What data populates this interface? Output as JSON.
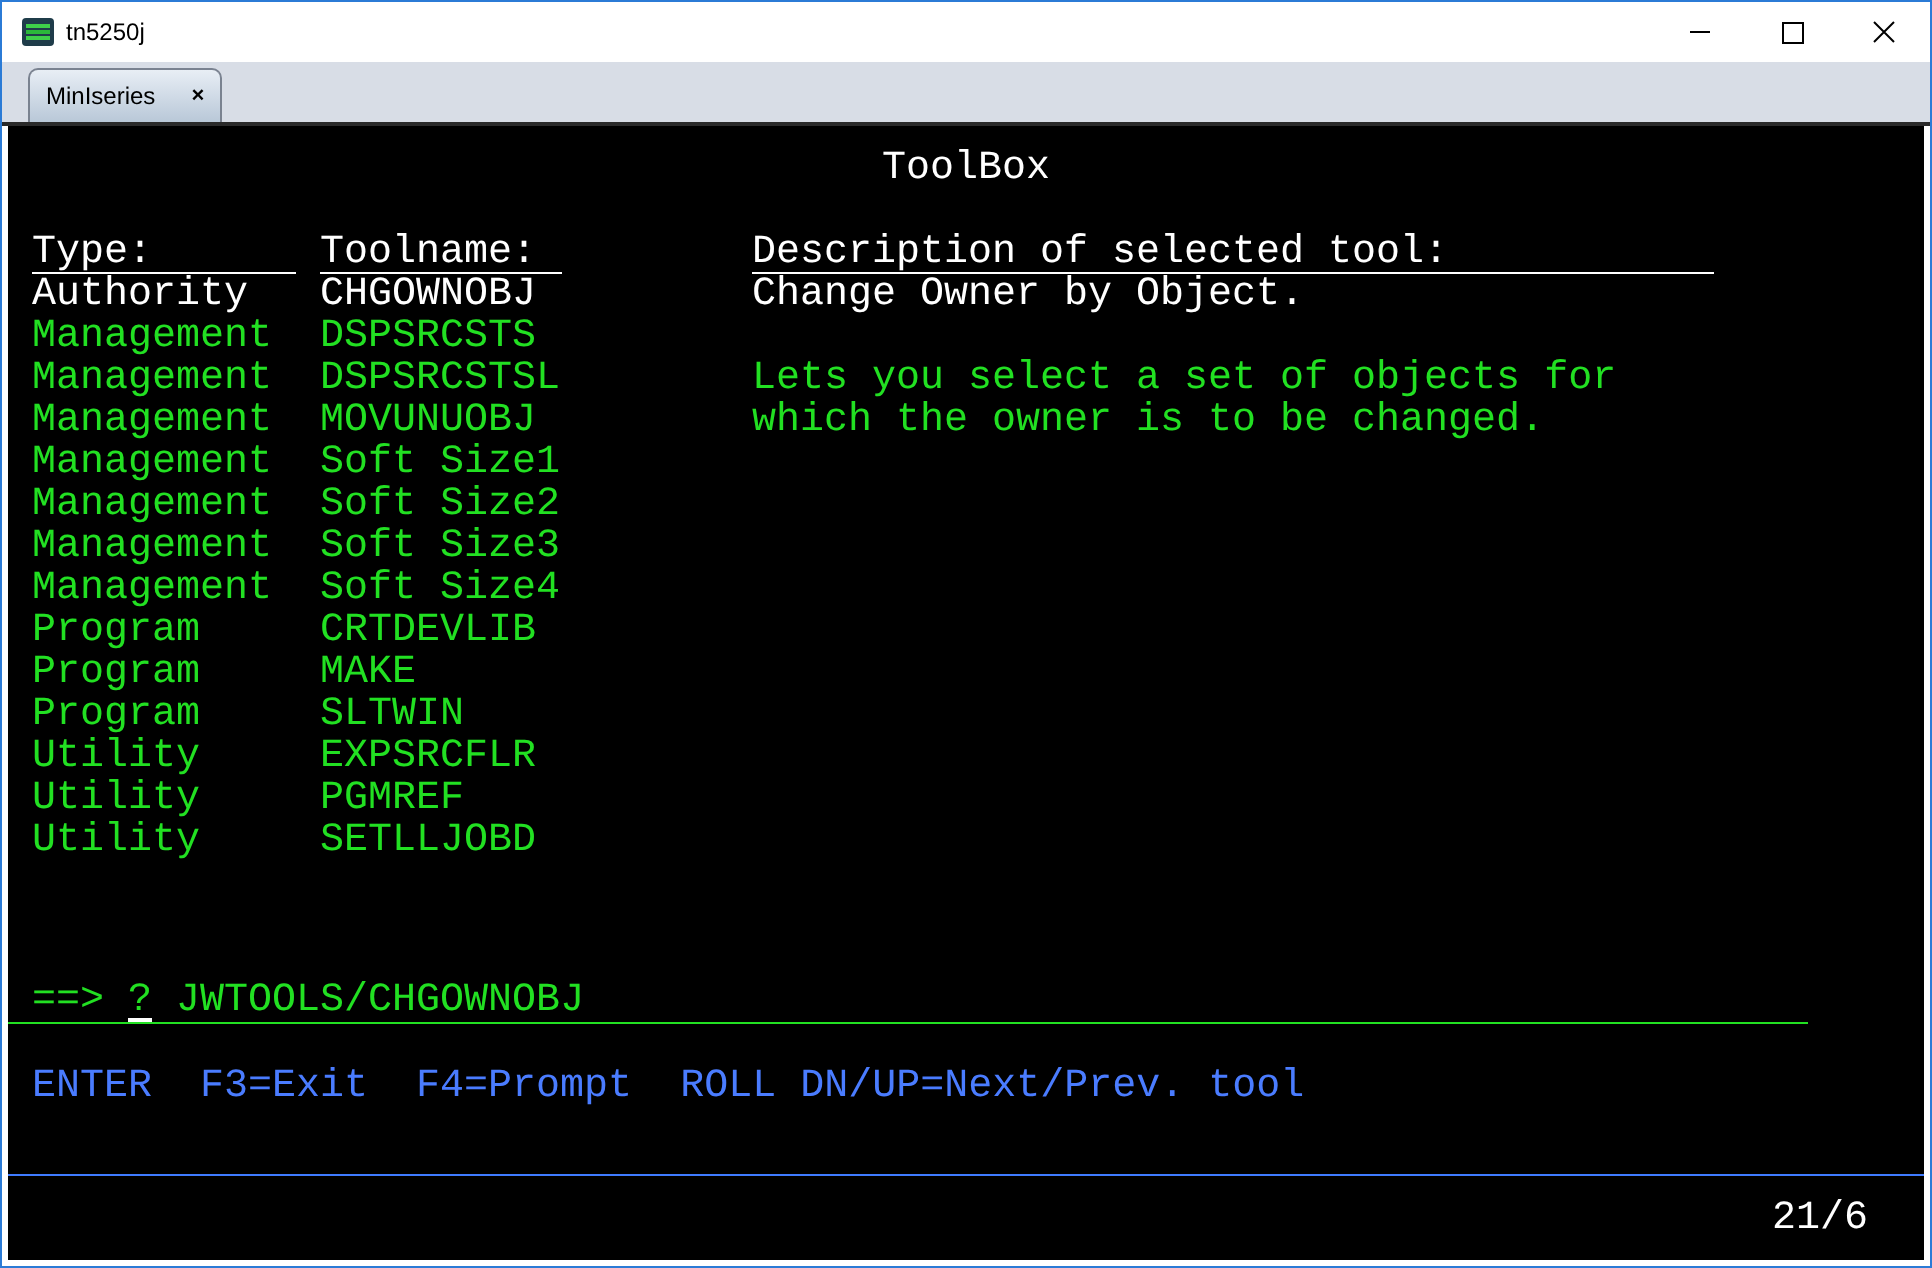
{
  "window": {
    "title": "tn5250j"
  },
  "tabs": [
    {
      "label": "MinIseries",
      "close": "×",
      "selected": true
    }
  ],
  "screen": {
    "title": "ToolBox",
    "columns": [
      "Type:",
      "Toolname:",
      "Description of selected tool:"
    ],
    "rows": [
      {
        "type": "Authority",
        "toolname": "CHGOWNOBJ",
        "selected": true
      },
      {
        "type": "Management",
        "toolname": "DSPSRCSTS",
        "selected": false
      },
      {
        "type": "Management",
        "toolname": "DSPSRCSTSL",
        "selected": false
      },
      {
        "type": "Management",
        "toolname": "MOVUNUOBJ",
        "selected": false
      },
      {
        "type": "Management",
        "toolname": "Soft Size1",
        "selected": false
      },
      {
        "type": "Management",
        "toolname": "Soft Size2",
        "selected": false
      },
      {
        "type": "Management",
        "toolname": "Soft Size3",
        "selected": false
      },
      {
        "type": "Management",
        "toolname": "Soft Size4",
        "selected": false
      },
      {
        "type": "Program",
        "toolname": "CRTDEVLIB",
        "selected": false
      },
      {
        "type": "Program",
        "toolname": "MAKE",
        "selected": false
      },
      {
        "type": "Program",
        "toolname": "SLTWIN",
        "selected": false
      },
      {
        "type": "Utility",
        "toolname": "EXPSRCFLR",
        "selected": false
      },
      {
        "type": "Utility",
        "toolname": "PGMREF",
        "selected": false
      },
      {
        "type": "Utility",
        "toolname": "SETLLJOBD",
        "selected": false
      }
    ],
    "description": {
      "title": "Change Owner by Object.",
      "lines": [
        "Lets you select a set of objects for",
        "which the owner is to be changed."
      ]
    },
    "command": {
      "prompt": "==>",
      "cursor": "?",
      "value": "JWTOOLS/CHGOWNOBJ"
    },
    "function_keys": [
      "ENTER",
      "F3=Exit",
      "F4=Prompt",
      "ROLL DN/UP=Next/Prev. tool"
    ]
  },
  "status_bar": {
    "position": "21/6"
  }
}
